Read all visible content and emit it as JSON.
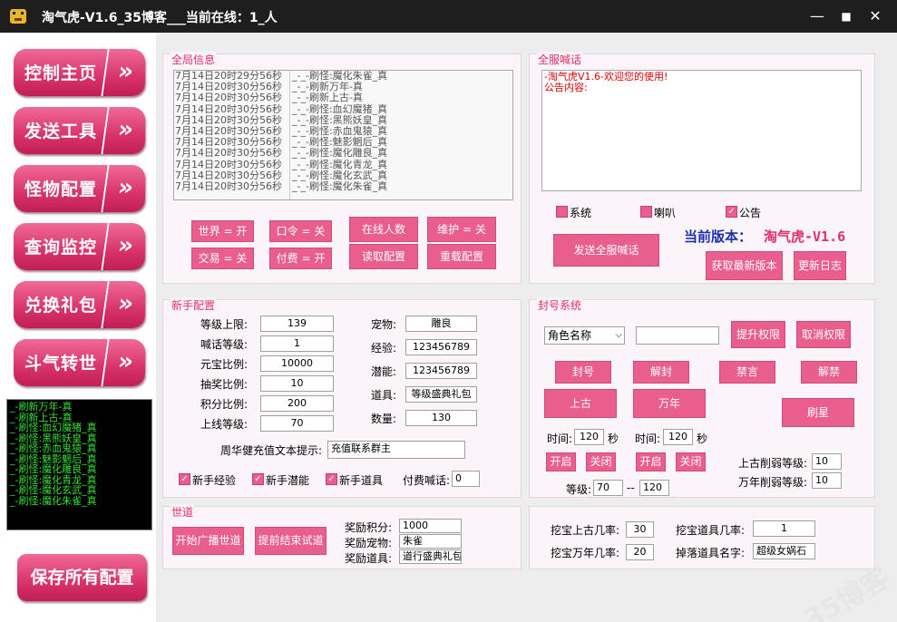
{
  "window": {
    "title": "淘气虎-V1.6_35博客___当前在线：1_人",
    "minimize": "—",
    "maximize": "■",
    "close": "✕"
  },
  "nav": {
    "items": [
      {
        "label": "控制主页"
      },
      {
        "label": "发送工具"
      },
      {
        "label": "怪物配置"
      },
      {
        "label": "查询监控"
      },
      {
        "label": "兑换礼包"
      },
      {
        "label": "斗气转世"
      }
    ],
    "arrow": "»",
    "save_label": "保存所有配置"
  },
  "console_log": [
    "_-刷新万年-真",
    "_-刷新上古-真",
    "_-刷怪:血幻魔猪_真",
    "_-刷怪:黑熊妖皇_真",
    "_-刷怪:赤血鬼猿_真",
    "_-刷怪:魅影魍后_真",
    "_-刷怪:魔化雕良_真",
    "_-刷怪:魔化青龙_真",
    "_-刷怪:魔化玄武_真",
    "_-刷怪:魔化朱雀_真"
  ],
  "global_info": {
    "title": "全局信息",
    "log": [
      {
        "time": "7月14日20时29分56秒",
        "msg": "_-_-刷怪:魔化朱雀_真"
      },
      {
        "time": "7月14日20时30分56秒",
        "msg": "_-_-刷新万年-真"
      },
      {
        "time": "7月14日20时30分56秒",
        "msg": "_-_-刷新上古-真"
      },
      {
        "time": "7月14日20时30分56秒",
        "msg": "_-_-刷怪:血幻魔猪_真"
      },
      {
        "time": "7月14日20时30分56秒",
        "msg": "_-_-刷怪:黑熊妖皇_真"
      },
      {
        "time": "7月14日20时30分56秒",
        "msg": "_-_-刷怪:赤血鬼猿_真"
      },
      {
        "time": "7月14日20时30分56秒",
        "msg": "_-_-刷怪:魅影魍后_真"
      },
      {
        "time": "7月14日20时30分56秒",
        "msg": "_-_-刷怪:魔化雕良_真"
      },
      {
        "time": "7月14日20时30分56秒",
        "msg": "_-_-刷怪:魔化青龙_真"
      },
      {
        "time": "7月14日20时30分56秒",
        "msg": "_-_-刷怪:魔化玄武_真"
      },
      {
        "time": "7月14日20时30分56秒",
        "msg": "_-_-刷怪:魔化朱雀_真"
      }
    ],
    "buttons": {
      "world": "世界 = 开",
      "password": "口令 = 关",
      "online_count": "在线人数",
      "maintain": "维护 = 关",
      "trade": "交易 = 关",
      "pay": "付费 = 开",
      "read_config": "读取配置",
      "reload_config": "重载配置"
    }
  },
  "server_broadcast": {
    "title": "全服喊话",
    "text_line1": "-淘气虎V1.6-欢迎您的使用!",
    "text_line2": "公告内容:",
    "checks": {
      "system": "系统",
      "horn": "喇叭",
      "notice": "公告",
      "notice_checked": "✓"
    },
    "send_button": "发送全服喊话",
    "version_label": "当前版本：",
    "version_value": "淘气虎-V1.6",
    "get_latest": "获取最新版本",
    "update_log": "更新日志"
  },
  "newbie": {
    "title": "新手配置",
    "fields": {
      "level_cap_label": "等级上限:",
      "level_cap": "139",
      "shout_level_label": "喊话等级:",
      "shout_level": "1",
      "ingot_ratio_label": "元宝比例:",
      "ingot_ratio": "10000",
      "lottery_ratio_label": "抽奖比例:",
      "lottery_ratio": "10",
      "points_ratio_label": "积分比例:",
      "points_ratio": "200",
      "online_level_label": "上线等级:",
      "online_level": "70",
      "pet_label": "宠物:",
      "pet": "雕良",
      "exp_label": "经验:",
      "exp": "123456789",
      "potential_label": "潜能:",
      "potential": "123456789",
      "item_label": "道具:",
      "item": "等级盛典礼包",
      "qty_label": "数量:",
      "qty": "130",
      "recharge_label": "周华健充值文本提示:",
      "recharge": "充值联系群主",
      "pay_shout_label": "付费喊话:",
      "pay_shout": "0"
    },
    "checks": {
      "exp": "新手经验",
      "potential": "新手潜能",
      "item": "新手道具",
      "mark": "✓"
    }
  },
  "ban": {
    "title": "封号系统",
    "select_value": "角色名称",
    "select_arrow": "⌵",
    "buttons": {
      "raise": "提升权限",
      "cancel": "取消权限",
      "ban": "封号",
      "unban": "解封",
      "mute": "禁言",
      "unmute": "解禁",
      "ancient": "上古",
      "wannian": "万年",
      "refresh": "刷星",
      "start1": "开启",
      "close1": "关闭",
      "start2": "开启",
      "close2": "关闭"
    },
    "time_label": "时间:",
    "time1": "120",
    "time2": "120",
    "sec": "秒",
    "ancient_weaken_label": "上古削弱等级:",
    "ancient_weaken": "10",
    "wannian_weaken_label": "万年削弱等级:",
    "wannian_weaken": "10",
    "level_label": "等级:",
    "level_min": "70",
    "level_sep": "--",
    "level_max": "120"
  },
  "world_path": {
    "title": "世道",
    "start_button": "开始广播世道",
    "end_button": "提前结束试道",
    "reward_points_label": "奖励积分:",
    "reward_points": "1000",
    "reward_pet_label": "奖励宠物:",
    "reward_pet": "朱雀",
    "reward_item_label": "奖励道具:",
    "reward_item": "道行盛典礼包"
  },
  "dig": {
    "ancient_rate_label": "挖宝上古几率:",
    "ancient_rate": "30",
    "wannian_rate_label": "挖宝万年几率:",
    "wannian_rate": "20",
    "item_rate_label": "挖宝道具几率:",
    "item_rate": "1",
    "drop_name_label": "掉落道具名字:",
    "drop_name": "超级女娲石"
  },
  "watermark": "35博客"
}
